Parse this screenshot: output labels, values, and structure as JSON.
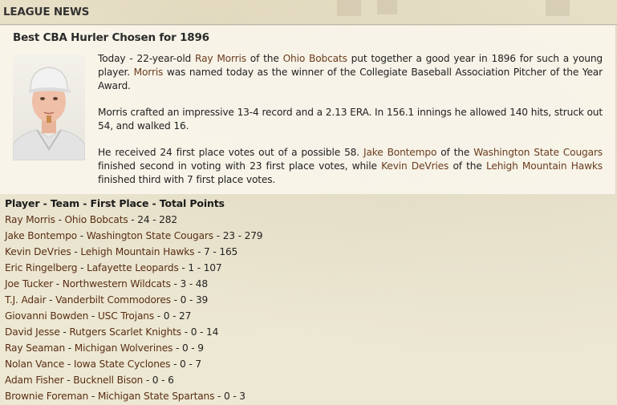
{
  "header": {
    "title": "LEAGUE NEWS"
  },
  "article": {
    "headline": "Best CBA Hurler Chosen for 1896",
    "photo": {
      "icon": "player-portrait"
    },
    "paragraphs": [
      [
        {
          "text": "Today - 22-year-old "
        },
        {
          "text": "Ray Morris",
          "link": true
        },
        {
          "text": " of the "
        },
        {
          "text": "Ohio Bobcats",
          "link": true
        },
        {
          "text": " put together a good year in 1896 for such a young player. "
        },
        {
          "text": "Morris",
          "link": true
        },
        {
          "text": " was named today as the winner of the Collegiate Baseball Association Pitcher of the Year Award."
        }
      ],
      [
        {
          "text": "Morris crafted an impressive 13-4 record and a 2.13 ERA. In 156.1 innings he allowed 140 hits, struck out 54, and walked 16."
        }
      ],
      [
        {
          "text": "He received 24 first place votes out of a possible 58. "
        },
        {
          "text": "Jake Bontempo",
          "link": true
        },
        {
          "text": " of the "
        },
        {
          "text": "Washington State Cougars",
          "link": true
        },
        {
          "text": " finished second in voting with 23 first place votes, while "
        },
        {
          "text": "Kevin DeVries",
          "link": true
        },
        {
          "text": " of the "
        },
        {
          "text": "Lehigh Mountain Hawks",
          "link": true
        },
        {
          "text": " finished third with 7 first place votes."
        }
      ]
    ]
  },
  "results": {
    "header": "Player - Team - First Place - Total Points",
    "rows": [
      {
        "player": "Ray Morris",
        "team": "Ohio Bobcats",
        "first": "24",
        "points": "282"
      },
      {
        "player": "Jake Bontempo",
        "team": "Washington State Cougars",
        "first": "23",
        "points": "279"
      },
      {
        "player": "Kevin DeVries",
        "team": "Lehigh Mountain Hawks",
        "first": "7",
        "points": "165"
      },
      {
        "player": "Eric Ringelberg",
        "team": "Lafayette Leopards",
        "first": "1",
        "points": "107"
      },
      {
        "player": "Joe Tucker",
        "team": "Northwestern Wildcats",
        "first": "3",
        "points": "48"
      },
      {
        "player": "T.J. Adair",
        "team": "Vanderbilt Commodores",
        "first": "0",
        "points": "39"
      },
      {
        "player": "Giovanni Bowden",
        "team": "USC Trojans",
        "first": "0",
        "points": "27"
      },
      {
        "player": "David Jesse",
        "team": "Rutgers Scarlet Knights",
        "first": "0",
        "points": "14"
      },
      {
        "player": "Ray Seaman",
        "team": "Michigan Wolverines",
        "first": "0",
        "points": "9"
      },
      {
        "player": "Nolan Vance",
        "team": "Iowa State Cyclones",
        "first": "0",
        "points": "7"
      },
      {
        "player": "Adam Fisher",
        "team": "Bucknell Bison",
        "first": "0",
        "points": "6"
      },
      {
        "player": "Brownie Foreman",
        "team": "Michigan State Spartans",
        "first": "0",
        "points": "3"
      }
    ]
  },
  "colors": {
    "link": "#6b3c1f",
    "panel": "#faf7ee",
    "background": "#ede8d3"
  }
}
